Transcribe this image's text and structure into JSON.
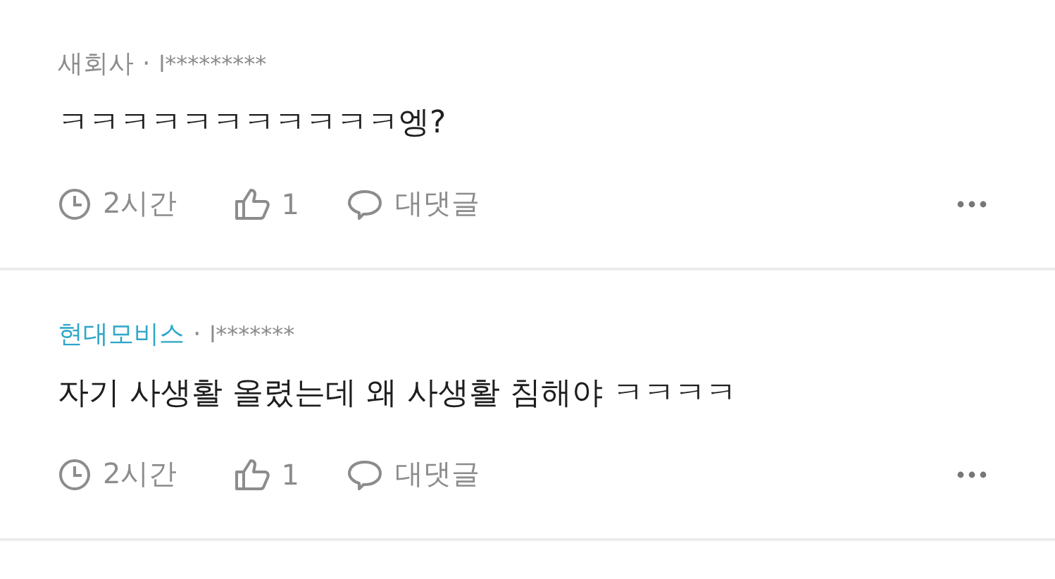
{
  "comments": [
    {
      "company": "새회사",
      "color": "#8c8c8c",
      "separator": "·",
      "user": "l*********",
      "body": "ㅋㅋㅋㅋㅋㅋㅋㅋㅋㅋㅋ엥?",
      "time": "2시간",
      "likes": "1",
      "reply": "대댓글"
    },
    {
      "company": "현대모비스",
      "color": "#2ea7c9",
      "separator": "·",
      "user": "l*******",
      "body": "자기 사생활 올렸는데 왜 사생활 침해야 ㅋㅋㅋㅋ",
      "time": "2시간",
      "likes": "1",
      "reply": "대댓글"
    }
  ]
}
